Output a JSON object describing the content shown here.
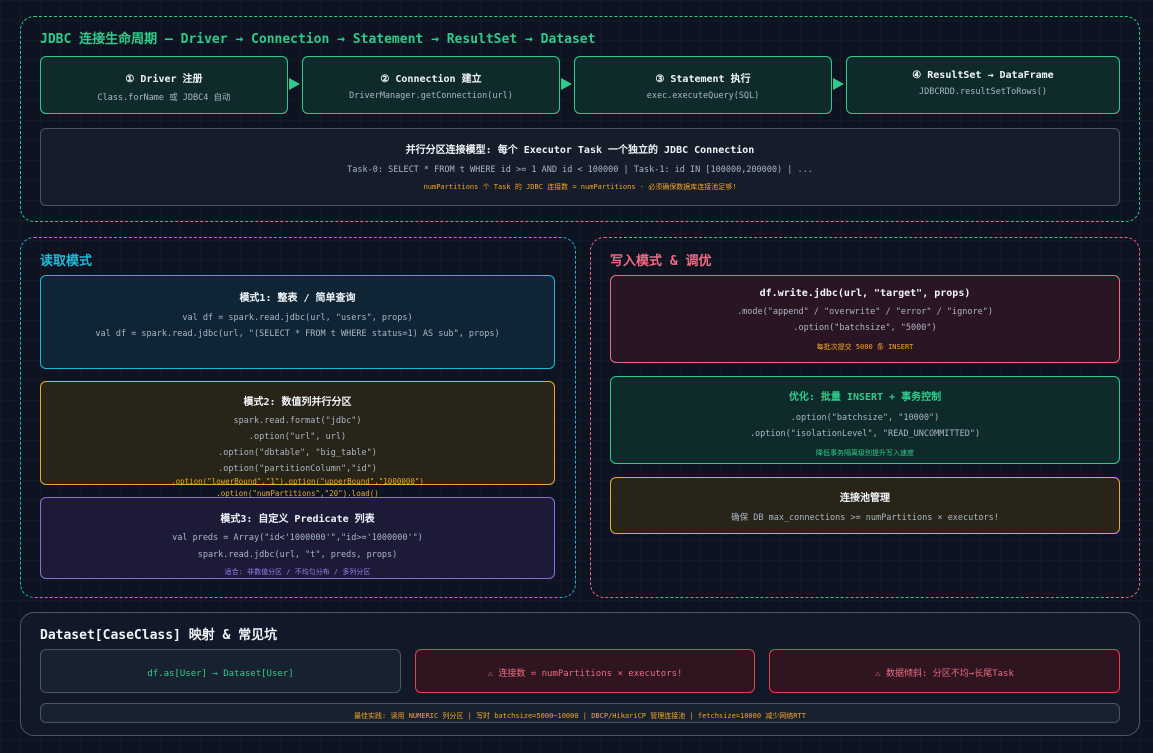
{
  "lifecycle": {
    "title": "JDBC 连接生命周期 — Driver → Connection → Statement → ResultSet → Dataset",
    "steps": [
      {
        "title": "① Driver 注册",
        "sub": "Class.forName 或 JDBC4 自动"
      },
      {
        "title": "② Connection 建立",
        "sub": "DriverManager.getConnection(url)"
      },
      {
        "title": "③ Statement 执行",
        "sub": "exec.executeQuery(SQL)"
      },
      {
        "title": "④ ResultSet → DataFrame",
        "sub": "JDBCRDD.resultSetToRows()"
      }
    ],
    "parallel": {
      "title": "并行分区连接模型: 每个 Executor Task 一个独立的 JDBC Connection",
      "line": "Task-0: SELECT * FROM t WHERE id >= 1 AND id < 100000 | Task-1: id IN [100000,200000) | ...",
      "note": "numPartitions 个 Task 的 JDBC 连接数 = numPartitions · 必须确保数据库连接池足够!"
    }
  },
  "read": {
    "title": "读取模式",
    "mode1": {
      "title": "模式1: 整表 / 简单查询",
      "lines": [
        "val df = spark.read.jdbc(url, \"users\", props)",
        "val df = spark.read.jdbc(url, \"(SELECT * FROM t WHERE status=1) AS sub\", props)"
      ]
    },
    "mode2": {
      "title": "模式2: 数值列并行分区",
      "lines": [
        "spark.read.format(\"jdbc\")",
        ".option(\"url\", url)",
        ".option(\"dbtable\", \"big_table\")",
        ".option(\"partitionColumn\",\"id\")",
        ".option(\"lowerBound\",\"1\").option(\"upperBound\",\"1000000\")",
        ".option(\"numPartitions\",\"20\").load()"
      ]
    },
    "mode3": {
      "title": "模式3: 自定义 Predicate 列表",
      "lines": [
        "val preds = Array(\"id<'1000000'\",\"id>='1000000'\")",
        "spark.read.jdbc(url, \"t\", preds, props)"
      ],
      "note": "适合: 非数值分区 / 不均匀分布 / 多列分区"
    }
  },
  "write": {
    "title": "写入模式 & 调优",
    "main": {
      "title": "df.write.jdbc(url, \"target\", props)",
      "lines": [
        ".mode(\"append\" / \"overwrite\" / \"error\" / \"ignore\")",
        ".option(\"batchsize\", \"5000\")"
      ],
      "note": "每批次提交 5000 条 INSERT"
    },
    "opt": {
      "title": "优化: 批量 INSERT + 事务控制",
      "lines": [
        ".option(\"batchsize\", \"10000\")",
        ".option(\"isolationLevel\", \"READ_UNCOMMITTED\")"
      ],
      "note": "降低事务隔离级别提升写入速度"
    },
    "pool": {
      "title": "连接池管理",
      "line": "确保 DB max_connections >= numPartitions × executors!"
    }
  },
  "dataset": {
    "title": "Dataset[CaseClass] 映射 & 常见坑",
    "items": [
      "df.as[User] → Dataset[User]",
      "⚠ 连接数 = numPartitions × executors!",
      "⚠ 数据倾斜: 分区不均→长尾Task"
    ],
    "best": "最佳实践: 读用 NUMERIC 列分区 | 写时 batchsize=5000~10000 | DBCP/HikariCP 管理连接池 | fetchsize=10000 减少网络RTT"
  }
}
